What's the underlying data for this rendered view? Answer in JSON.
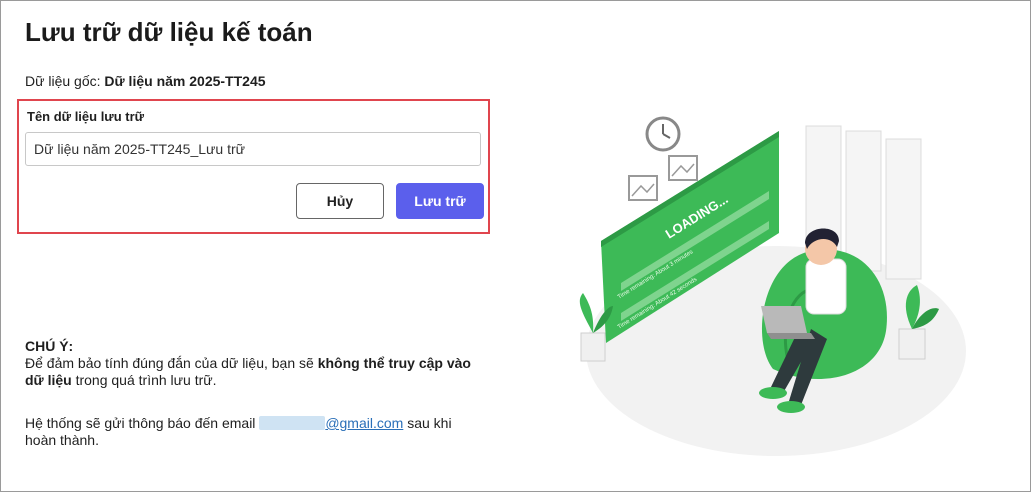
{
  "page": {
    "title": "Lưu trữ dữ liệu kế toán"
  },
  "source": {
    "label": "Dữ liệu gốc:",
    "value": "Dữ liệu năm 2025-TT245"
  },
  "form": {
    "field_label": "Tên dữ liệu lưu trữ",
    "name_value": "Dữ liệu năm 2025-TT245_Lưu trữ",
    "cancel_label": "Hủy",
    "save_label": "Lưu trữ"
  },
  "note": {
    "title": "CHÚ Ý:",
    "text_before": "Để đảm bảo tính đúng đắn của dữ liệu, bạn sẽ",
    "text_bold": "không thể truy cập vào dữ liệu",
    "text_after": "trong quá trình lưu trữ."
  },
  "email_notice": {
    "text_before": "Hệ thống sẽ gửi thông báo đến email",
    "email_domain": "@gmail.com",
    "text_after": "sau khi hoàn thành."
  },
  "illustration": {
    "loading_text": "LOADING...",
    "line1": "Time remaining: About 3 minutes",
    "line2": "Time remaining: About 42 seconds"
  },
  "colors": {
    "accent": "#5b5fec",
    "highlight_border": "#e0454e",
    "link": "#2a6fb8",
    "illustration_green": "#3dba57"
  }
}
